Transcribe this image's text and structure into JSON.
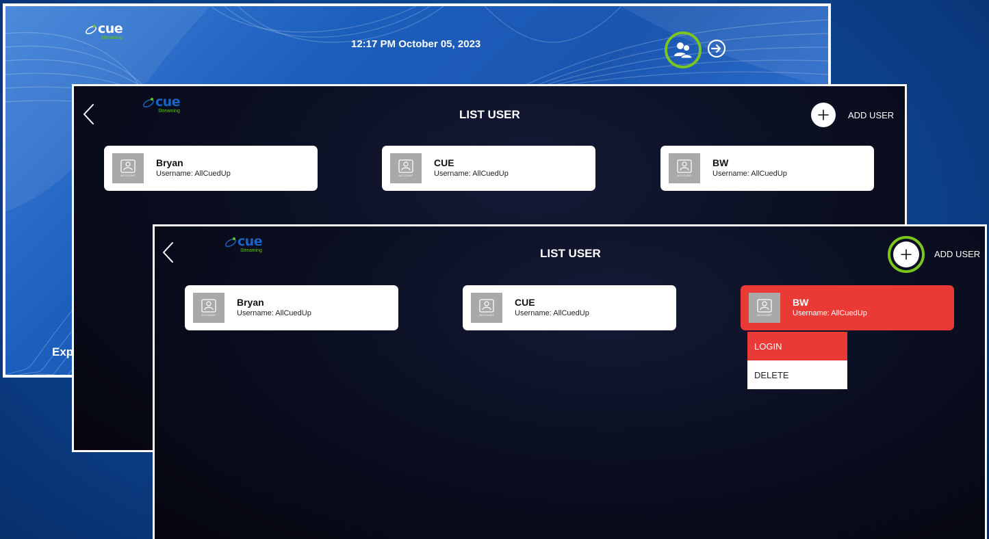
{
  "brand": {
    "word": "cue",
    "sub": "Streaming"
  },
  "home": {
    "datetime": "12:17 PM  October 05, 2023",
    "partial_text": "Exp"
  },
  "list_panel_back": {
    "title": "LIST USER",
    "add_label": "ADD USER",
    "users": [
      {
        "name": "Bryan",
        "username": "Username: AllCuedUp"
      },
      {
        "name": "CUE",
        "username": "Username: AllCuedUp"
      },
      {
        "name": "BW",
        "username": "Username: AllCuedUp"
      }
    ]
  },
  "list_panel_front": {
    "title": "LIST USER",
    "add_label": "ADD USER",
    "users": [
      {
        "name": "Bryan",
        "username": "Username: AllCuedUp"
      },
      {
        "name": "CUE",
        "username": "Username: AllCuedUp"
      },
      {
        "name": "BW",
        "username": "Username: AllCuedUp",
        "selected": true
      }
    ],
    "context_menu": {
      "login": "LOGIN",
      "delete": "DELETE"
    }
  },
  "account_icon_caption": "ACCOUNT",
  "colors": {
    "highlight_ring": "#7ac51f",
    "selected_red": "#e93a36",
    "panel_dark": "#0b0f22",
    "brand_blue": "#1b63c7",
    "brand_green": "#66c12a"
  },
  "icons": [
    "cue-logo-icon",
    "users-icon",
    "login-arrow-icon",
    "back-chevron-icon",
    "plus-icon",
    "account-icon"
  ]
}
